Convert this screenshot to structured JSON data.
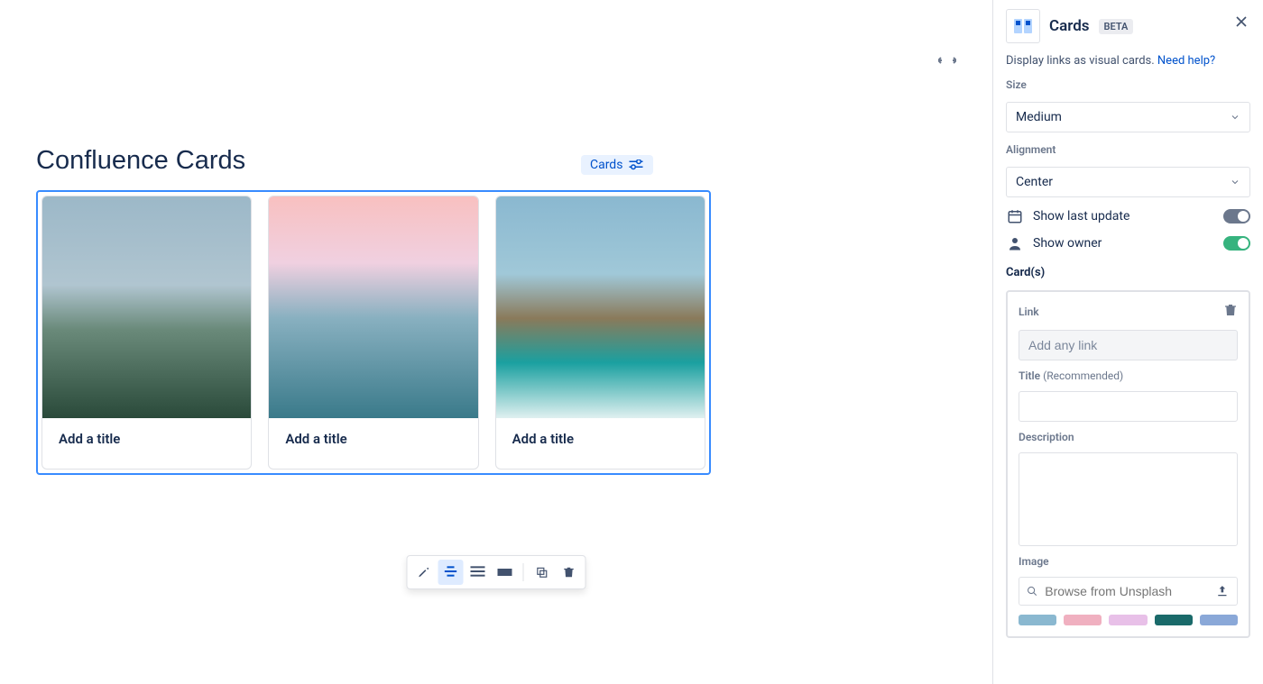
{
  "page_title": "Confluence Cards",
  "macro_chip_label": "Cards",
  "cards": [
    {
      "title": "Add a title"
    },
    {
      "title": "Add a title"
    },
    {
      "title": "Add a title"
    }
  ],
  "panel": {
    "title": "Cards",
    "badge": "BETA",
    "caption_text": "Display links as visual cards.",
    "help_link": "Need help?",
    "size_label": "Size",
    "size_value": "Medium",
    "alignment_label": "Alignment",
    "alignment_value": "Center",
    "show_last_update_label": "Show last update",
    "show_last_update_on": false,
    "show_owner_label": "Show owner",
    "show_owner_on": true,
    "cards_heading": "Card(s)",
    "link_label": "Link",
    "link_placeholder": "Add any link",
    "title_label": "Title",
    "title_rec": "(Recommended)",
    "description_label": "Description",
    "image_label": "Image",
    "image_search_placeholder": "Browse from Unsplash"
  },
  "thumb_colors": [
    "#8ab8d0",
    "#f0b0c0",
    "#e8c0e8",
    "#1a6a6a",
    "#8aa8d8"
  ]
}
